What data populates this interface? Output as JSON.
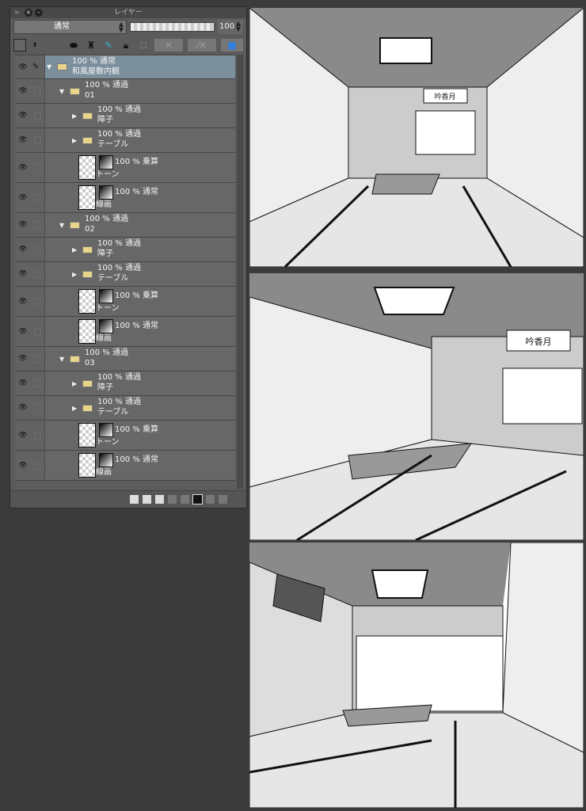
{
  "panel": {
    "title": "レイヤー",
    "blend_mode": "通常",
    "opacity": "100"
  },
  "layers": [
    {
      "kind": "folder",
      "depth": 0,
      "mode": "100 % 通常",
      "name": "和風屋敷内観",
      "selected": true,
      "open": true
    },
    {
      "kind": "folder",
      "depth": 1,
      "mode": "100 % 通過",
      "name": "01",
      "open": true
    },
    {
      "kind": "folder",
      "depth": 2,
      "mode": "100 % 通過",
      "name": "障子",
      "open": false
    },
    {
      "kind": "folder",
      "depth": 2,
      "mode": "100 % 通過",
      "name": "テーブル",
      "open": false
    },
    {
      "kind": "layer",
      "depth": 2,
      "mode": "100 % 乗算",
      "name": "トーン"
    },
    {
      "kind": "layer",
      "depth": 2,
      "mode": "100 % 通常",
      "name": "線画"
    },
    {
      "kind": "folder",
      "depth": 1,
      "mode": "100 % 通過",
      "name": "02",
      "open": true
    },
    {
      "kind": "folder",
      "depth": 2,
      "mode": "100 % 通過",
      "name": "障子",
      "open": false
    },
    {
      "kind": "folder",
      "depth": 2,
      "mode": "100 % 通過",
      "name": "テーブル",
      "open": false
    },
    {
      "kind": "layer",
      "depth": 2,
      "mode": "100 % 乗算",
      "name": "トーン"
    },
    {
      "kind": "layer",
      "depth": 2,
      "mode": "100 % 通常",
      "name": "線画"
    },
    {
      "kind": "folder",
      "depth": 1,
      "mode": "100 % 通過",
      "name": "03",
      "open": true
    },
    {
      "kind": "folder",
      "depth": 2,
      "mode": "100 % 通過",
      "name": "障子",
      "open": false
    },
    {
      "kind": "folder",
      "depth": 2,
      "mode": "100 % 通過",
      "name": "テーブル",
      "open": false
    },
    {
      "kind": "layer",
      "depth": 2,
      "mode": "100 % 乗算",
      "name": "トーン"
    },
    {
      "kind": "layer",
      "depth": 2,
      "mode": "100 % 通常",
      "name": "線画"
    }
  ],
  "panels": [
    {
      "scroll": "吟香月"
    },
    {
      "scroll": "吟香月"
    },
    {
      "scroll": ""
    }
  ]
}
